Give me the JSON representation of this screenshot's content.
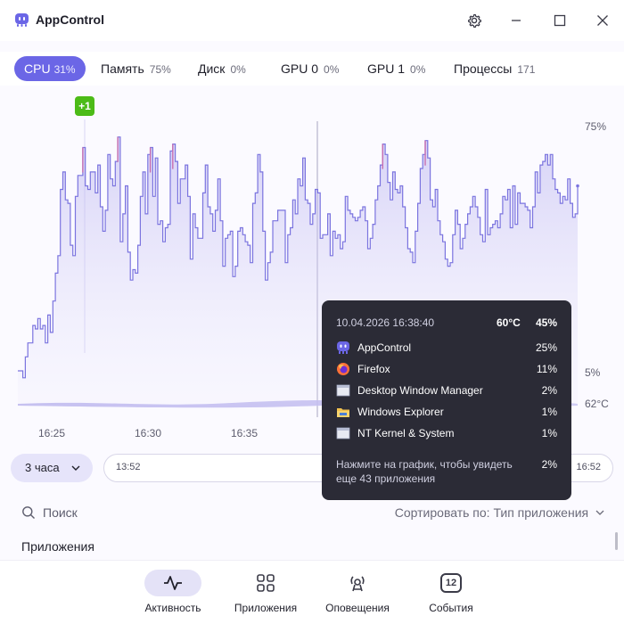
{
  "app": {
    "title": "AppControl"
  },
  "tabs": [
    {
      "label": "CPU",
      "value": "31%"
    },
    {
      "label": "Память",
      "value": "75%"
    },
    {
      "label": "Диск",
      "value": "0%"
    },
    {
      "label": "GPU 0",
      "value": "0%"
    },
    {
      "label": "GPU 1",
      "value": "0%"
    },
    {
      "label": "Процессы",
      "value": "171"
    }
  ],
  "chart": {
    "event_badge": "+1",
    "y_top_label": "75%",
    "y_bottom_label": "5%",
    "temp_label": "62°C",
    "time_labels": [
      "16:25",
      "16:30",
      "16:35"
    ],
    "line_color": "#7b74df",
    "peak_color": "#c86fb0"
  },
  "chart_data": {
    "type": "line",
    "xlabel": "",
    "ylabel": "",
    "ylim": [
      5,
      75
    ],
    "series": [
      {
        "values": [
          5,
          5,
          3,
          9,
          13,
          13,
          18,
          17,
          20,
          17,
          18,
          13,
          21,
          16,
          25,
          33,
          38,
          57,
          62,
          54,
          53,
          41,
          38,
          55,
          61,
          61,
          69,
          58,
          57,
          62,
          62,
          56,
          64,
          52,
          45,
          51,
          67,
          60,
          58,
          65,
          72,
          42,
          50,
          58,
          39,
          31,
          34,
          33,
          41,
          55,
          62,
          50,
          67,
          69,
          55,
          66,
          47,
          48,
          42,
          46,
          47,
          68,
          70,
          65,
          53,
          60,
          60,
          64,
          55,
          37,
          50,
          46,
          43,
          43,
          56,
          64,
          52,
          50,
          45,
          51,
          60,
          48,
          35,
          43,
          44,
          45,
          32,
          35,
          45,
          46,
          44,
          42,
          41,
          36,
          53,
          56,
          67,
          62,
          45,
          31,
          36,
          39,
          48,
          48,
          51,
          51,
          51,
          36,
          44,
          46,
          54,
          50,
          60,
          58,
          66,
          54,
          53,
          47,
          50,
          57,
          56,
          43,
          44,
          44,
          50,
          38,
          45,
          43,
          44,
          40,
          42,
          55,
          51,
          50,
          49,
          48,
          49,
          51,
          52,
          48,
          40,
          43,
          47,
          54,
          58,
          64,
          70,
          67,
          59,
          54,
          62,
          57,
          56,
          58,
          52,
          46,
          40,
          39,
          36,
          45,
          53,
          63,
          67,
          71,
          66,
          54,
          52,
          57,
          48,
          44,
          42,
          37,
          35,
          36,
          44,
          51,
          47,
          40,
          43,
          47,
          50,
          52,
          55,
          52,
          49,
          44,
          42,
          57,
          44,
          46,
          47,
          48,
          46,
          50,
          55,
          54,
          57,
          46,
          58,
          47,
          56,
          53,
          53,
          52,
          51,
          46,
          52,
          62,
          56,
          64,
          65,
          67,
          64,
          67,
          60,
          57,
          56,
          53,
          55,
          54,
          60,
          53,
          49,
          50,
          58
        ]
      }
    ]
  },
  "controls": {
    "range_label": "3 часа",
    "timeline_start": "13:52",
    "timeline_end": "16:52"
  },
  "search": {
    "placeholder": "Поиск",
    "sort_label": "Сортировать по: Тип приложения"
  },
  "section": {
    "title": "Приложения"
  },
  "tooltip": {
    "time": "10.04.2026 16:38:40",
    "temp": "60°C",
    "load": "45%",
    "rows": [
      {
        "name": "AppControl",
        "pct": "25%",
        "icon": "appcontrol-icon"
      },
      {
        "name": "Firefox",
        "pct": "11%",
        "icon": "firefox-icon"
      },
      {
        "name": "Desktop Window Manager",
        "pct": "2%",
        "icon": "window-icon"
      },
      {
        "name": "Windows Explorer",
        "pct": "1%",
        "icon": "folder-icon"
      },
      {
        "name": "NT Kernel & System",
        "pct": "1%",
        "icon": "window-icon"
      }
    ],
    "note": "Нажмите на график, чтобы увидеть еще 43 приложения",
    "note_pct": "2%"
  },
  "nav": [
    {
      "label": "Активность",
      "icon": "activity-icon"
    },
    {
      "label": "Приложения",
      "icon": "apps-grid-icon"
    },
    {
      "label": "Оповещения",
      "icon": "alerts-icon"
    },
    {
      "label": "События",
      "badge": "12",
      "icon": "events-icon"
    }
  ]
}
